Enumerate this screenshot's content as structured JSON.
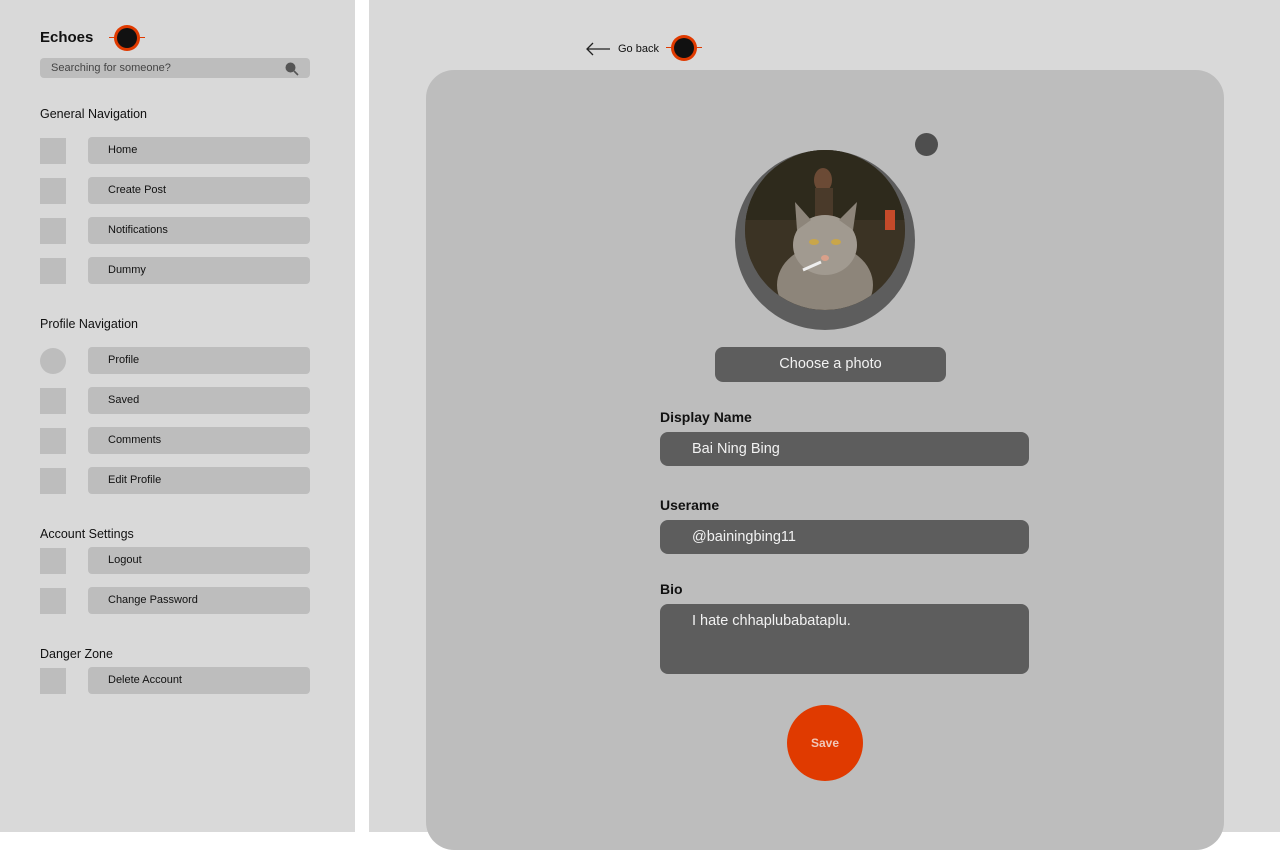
{
  "app": {
    "brand": "Echoes",
    "accent_color": "#e03a00"
  },
  "search": {
    "placeholder": "Searching for someone?"
  },
  "sidebar": {
    "sections": [
      {
        "title": "General Navigation",
        "items": [
          {
            "label": "Home",
            "icon": "square-icon"
          },
          {
            "label": "Create Post",
            "icon": "square-icon"
          },
          {
            "label": "Notifications",
            "icon": "square-icon"
          },
          {
            "label": "Dummy",
            "icon": "square-icon"
          }
        ]
      },
      {
        "title": "Profile Navigation",
        "items": [
          {
            "label": "Profile",
            "icon": "circle-icon"
          },
          {
            "label": "Saved",
            "icon": "square-icon"
          },
          {
            "label": "Comments",
            "icon": "square-icon"
          },
          {
            "label": "Edit Profile",
            "icon": "square-icon"
          }
        ]
      },
      {
        "title": "Account Settings",
        "items": [
          {
            "label": "Logout",
            "icon": "square-icon"
          },
          {
            "label": "Change Password",
            "icon": "square-icon"
          }
        ]
      },
      {
        "title": "Danger Zone",
        "items": [
          {
            "label": "Delete Account",
            "icon": "square-icon"
          }
        ]
      }
    ]
  },
  "main": {
    "go_back": "Go back",
    "choose_photo": "Choose a photo",
    "fields": {
      "display_name": {
        "label": "Display Name",
        "value": "Bai Ning Bing"
      },
      "username": {
        "label": "Userame",
        "value": "@bainingbing11"
      },
      "bio": {
        "label": "Bio",
        "value": "I hate chhaplubabataplu."
      }
    },
    "save": "Save"
  }
}
